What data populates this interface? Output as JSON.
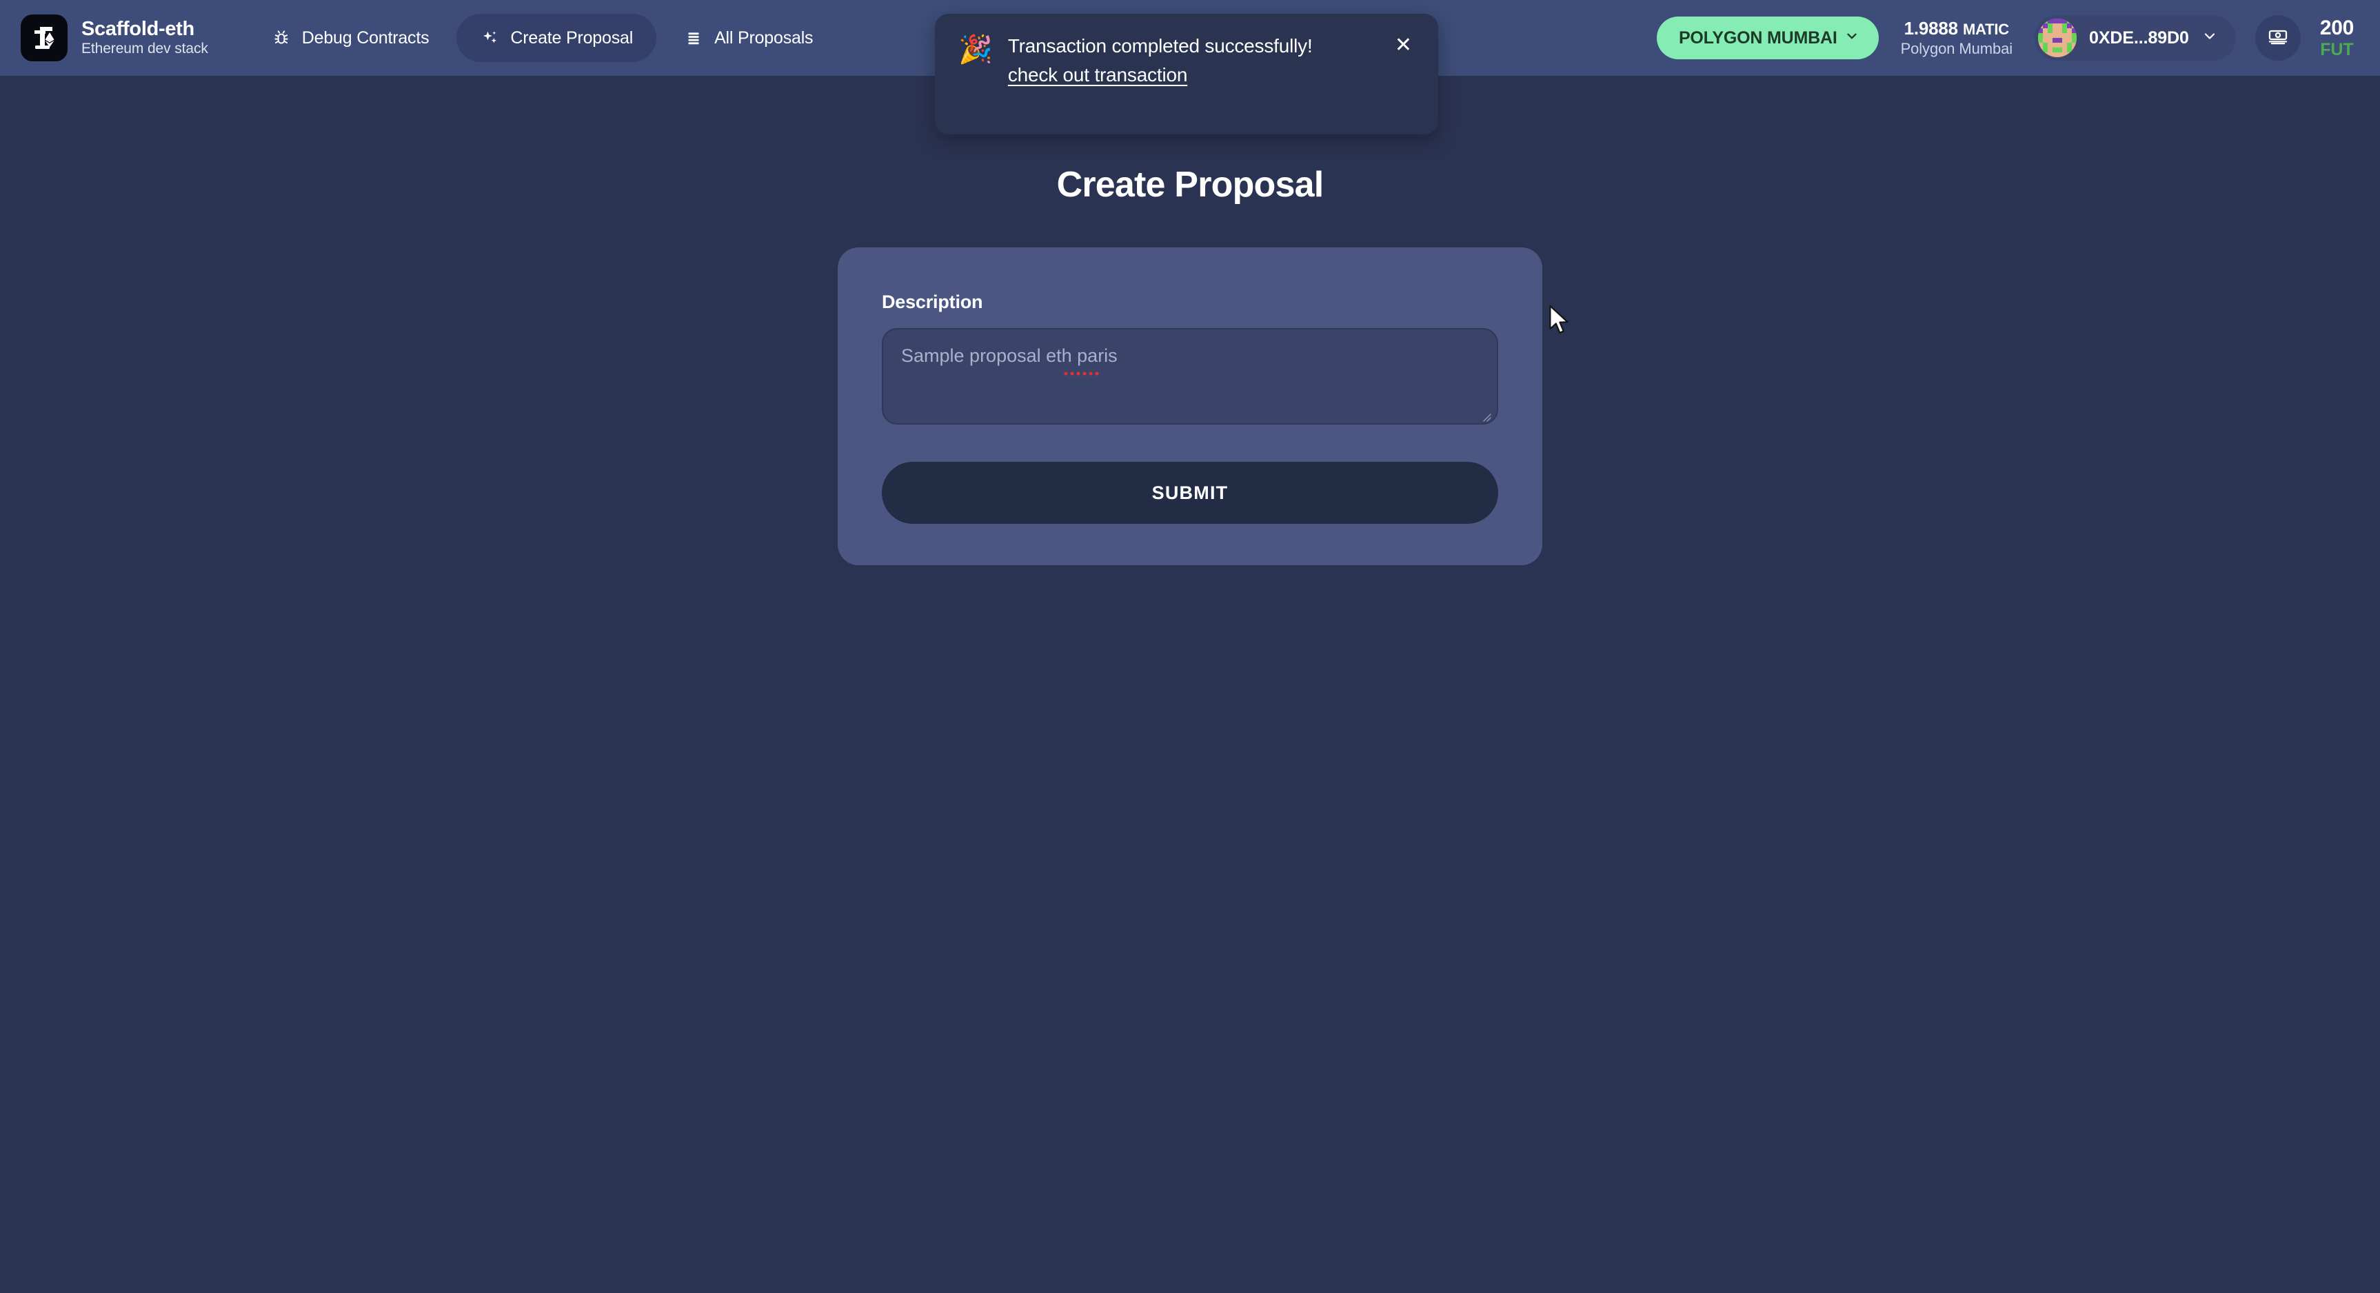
{
  "header": {
    "brand": {
      "logo_icon": "scaffold-eth-logo-icon",
      "title": "Scaffold-eth",
      "subtitle": "Ethereum dev stack"
    },
    "nav": [
      {
        "label": "Debug Contracts",
        "icon": "bug-icon",
        "active": false
      },
      {
        "label": "Create Proposal",
        "icon": "sparkles-icon",
        "active": true
      },
      {
        "label": "All Proposals",
        "icon": "list-icon",
        "active": false
      }
    ],
    "network": {
      "label": "POLYGON MUMBAI",
      "chevron_icon": "chevron-down-icon",
      "pill_color": "#85edb4",
      "text_color": "#1d3a28"
    },
    "balance": {
      "amount": "1.9888",
      "unit": "MATIC",
      "network_name": "Polygon Mumbai"
    },
    "wallet": {
      "avatar_icon": "blockie-avatar",
      "address": "0XDE...89D0",
      "chevron_icon": "chevron-down-icon"
    },
    "faucet_button": {
      "icon": "banknote-icon"
    },
    "token": {
      "amount": "200",
      "symbol": "FUT",
      "symbol_color": "#4caa52"
    }
  },
  "toast": {
    "emoji": "🎉",
    "message": "Transaction completed successfully!",
    "link": "check out transaction",
    "close_icon": "close-icon",
    "background": "#2a3350"
  },
  "main": {
    "page_title": "Create Proposal",
    "form": {
      "description_label": "Description",
      "description_value": "",
      "description_placeholder": "Sample proposal eth paris",
      "submit_label": "SUBMIT"
    }
  },
  "theme": {
    "page_background": "#2b3352",
    "header_background": "#3d4c78",
    "card_background": "#4b5782",
    "input_background": "#3a4468",
    "submit_background": "#222c44"
  }
}
